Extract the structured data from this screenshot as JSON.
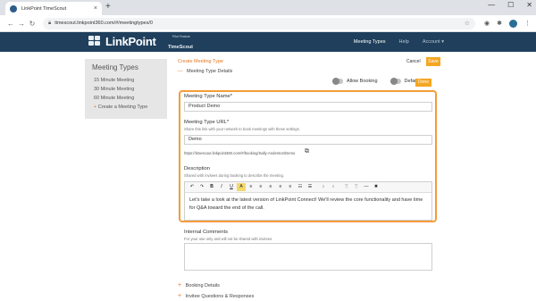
{
  "browser": {
    "tab_title": "LinkPoint TimeScout",
    "tab_close": "×",
    "new_tab": "+",
    "url": "timescout.linkpoint360.com/#/meetingtypes/0",
    "win_min": "—",
    "win_max": "☐",
    "win_close": "✕"
  },
  "app": {
    "logo_text": "LinkPoint",
    "logo_sub": "TimeScout",
    "logo_pilot": "Pilot Feature",
    "nav": [
      {
        "label": "Meeting Types",
        "active": true
      },
      {
        "label": "Help",
        "active": false
      },
      {
        "label": "Account ▾",
        "active": false
      }
    ]
  },
  "sidebar": {
    "title": "Meeting Types",
    "items": [
      {
        "label": "15 Minute Meeting"
      },
      {
        "label": "30 Minute Meeting"
      },
      {
        "label": "60 Minute Meeting"
      },
      {
        "prefix": "+",
        "label": "Create a Meeting Type"
      }
    ]
  },
  "main": {
    "breadcrumb": "Create Meeting Type",
    "cancel_label": "Cancel",
    "save_label": "Save",
    "section_title": "Meeting Type Details",
    "section_toggle": "—",
    "allow_booking_label": "Allow Booking",
    "default_label": "Default",
    "done_label": "Done",
    "name_label": "Meeting Type Name*",
    "name_value": "Product Demo",
    "url_label": "Meeting Type URL*",
    "url_hint": "Share this link with your network to book meetings with these settings.",
    "url_value": "Demo",
    "url_full": "https://timescout.linkpoint360.com/#/booking/Sally-Anderson/Demo",
    "desc_label": "Description",
    "desc_hint": "Shared with invitees during booking to describe the meeting.",
    "toolbar": [
      "↶",
      "↷",
      "B",
      "I",
      "U",
      "A",
      "≡",
      "≡",
      "≡",
      "≡",
      "≡",
      "☷",
      "☰",
      "↕",
      "↕",
      "⎘",
      "⎘",
      "—",
      "✖"
    ],
    "desc_value": "Let's take a look at the latest version of LinkPoint Connect! We'll review the core functionality and have time for Q&A toward the end of the call.",
    "comments_label": "Internal Comments",
    "comments_hint": "For your use only and will not be shared with invitees.",
    "comments_value": "",
    "collapsed": [
      {
        "label": "Booking Details",
        "toggle": "+"
      },
      {
        "label": "Invitee Questions & Responses",
        "toggle": "+"
      }
    ]
  }
}
